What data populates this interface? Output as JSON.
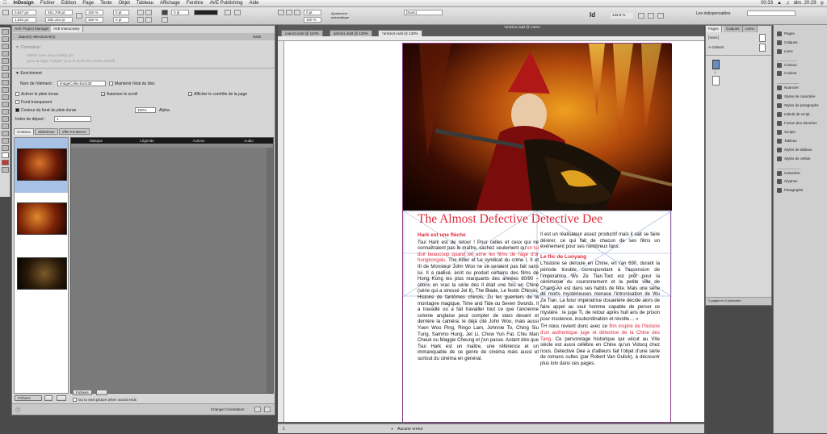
{
  "menubar": {
    "apple": "",
    "app": "InDesign",
    "items": [
      "Fichier",
      "Edition",
      "Page",
      "Texte",
      "Objet",
      "Tableau",
      "Affichage",
      "Fenêtre",
      "AVE Publishing",
      "Aide"
    ],
    "time": "dim. 20:29",
    "battery": "00:33"
  },
  "control": {
    "x": "0,847 po",
    "y": "1,534 po",
    "w": "451,705 pt",
    "h": "282,164 pt",
    "stroke": "0 pt",
    "zoom": "100 %",
    "zoom2": "100 %",
    "anchor": "Ajustement automatique",
    "swatch": "[Sans]",
    "percent": "133,9 %",
    "workspace": "Les indispensables"
  },
  "ave_panel": {
    "tabs": [
      "AVE Project Manager",
      "AVE Interactivity"
    ],
    "header": "diapo(s) sélectionné(s)",
    "header_id": "4025",
    "section_theme": "Thématiser",
    "theme_note1": "Utiliser avec ceux créé(s) par",
    "theme_note2": "(pour la règle \"Calque\" pour le mode de couleur intuitif)",
    "section_enrich": "Enrichiment",
    "element_label": "Nom de l'élément :",
    "element_value": "imageCollection235",
    "keep_state": "Maintenir l'état du bloc",
    "fullscreen": "Activer le plein écran",
    "allow_scroll": "Autoriser le scroll",
    "show_controls": "Afficher le contrôle de la page",
    "transparent_bg": "Fond transparent",
    "bg_color": "Couleur du fond du plein écran",
    "alpha_value": "100%",
    "alpha_label": "Alpha",
    "start_index_label": "Index de départ :",
    "start_index_value": "1",
    "subtabs": [
      "Contenu",
      "Slideshow",
      "effet KenBurns"
    ],
    "columns": [
      "Masque",
      "Légende",
      "Actions",
      "Audio"
    ],
    "files_btn": "Fichiers",
    "files_btn2": "Fichiers",
    "goto_next": "Go to next picture when sound ends",
    "orientation_label": "Changer l'orientation :"
  },
  "document": {
    "tabs": [
      "coeur2.indd @ 110%",
      "article1.indd @ 130%",
      "*article2.indd @ 130%"
    ],
    "window_title": "*article2.indd @ 130%",
    "title": "The Almost Defective Detective Dee",
    "col1": {
      "h1": "Hark est une flèche",
      "p1a": "Tsui Hark est de retour ! Pour celles et ceux qui ne connaîtraient pas le maître, sachez seulement qu'",
      "p1red": "on lui doit beaucoup quand on aime les films de l'âge d'or hongkongais",
      "p1b": ". The Killer et Le syndicat du crime I, II et III de Monsieur John Woo ne se seraient pas fait sans lui. Il a réalisé, écrit ou produit certains des films de Hong Kong les plus marquants des années 80/90 – citons en vrac la série des Il était une fois en Chine (série qui a stressé Jet li), The Blade, Le festin Chinois, Histoire de fantômes chinois, Zu les guerriers de la montagne magique, Time and Tide ou Seven Swords. Il a travaillé ou a fait travailler tout ce que l'ancienne colonie anglaise peut compter de stars devant et derrière la caméra: le déjà cité John Woo, mais aussi Yuen Woo Ping, Ringo Lam, Johnnie To, Ching Siu Tung, Sammo Hung, Jet Li, Chow Yun Fat, Chiu Man Cheuk ou Maggie Cheung et j'en passe. Autant dire que Tsui Hark est un maître, une référence et un immanquable de ce genre de cinéma mais aussi et surtout du cinéma en général."
    },
    "col2": {
      "p0": "Il est un réalisateur assez productif mais il sait se faire désirer, ce qui fait de chacun de ses films un événement pour ses nombreux fans.",
      "h2": "Le flic de Luoyang",
      "p2": "L'histoire se déroule en Chine, en l'an 690, durant la période trouble correspondant à l'ascension de l'impératrice Wu Ze Tian.Tout est prêt pour la cérémonie du couronnement et la petite ville de Chang-An est dans ses habits de fête. Mais une série de morts mystérieuses menace l'intronisation de Wu Ze Tian. La futur impératrice douairière décide alors de faire appel au seul homme capable de percer ce mystère : le juge Ti, de retour après huit ans de prison pour insolence, insubordination et révolte… »",
      "p3a": "TH nous revient donc avec ce ",
      "p3red": "film inspiré de l'histoire d'un authentique juge et détective de la Chine des Tang",
      "p3b": ". Ce personnage historique qui vécut au VIIe siècle est aussi célèbre en Chine qu'un Vidocq chez nous. Detective Dee a d'ailleurs fait l'objet d'une série de romans cultes (par Robert Van Gulick), à découvrir plus loin dans ces pages."
    },
    "status_zoom": "1",
    "status_errors": "Aucune erreur"
  },
  "pages_panel": {
    "tabs": [
      "Pages",
      "Calques",
      "Liens"
    ],
    "master1": "[Sans]",
    "master2": "A-Gabarit",
    "page_num": "1",
    "footer": "2 pages en 2 planches"
  },
  "side_panel": {
    "items": [
      "Pages",
      "Calques",
      "Liens",
      "Contour",
      "Couleur",
      "Nuancier",
      "Styles de caractère",
      "Styles de paragraphe",
      "Intitulé de script",
      "Fusion des données",
      "Scripts",
      "Tableau",
      "Styles de tableau",
      "Styles de cellule",
      "Caractère",
      "Glyphes",
      "Paragraphe"
    ]
  },
  "colors": {
    "accent_red": "#e0283a",
    "page_border": "#8a3a8a"
  }
}
